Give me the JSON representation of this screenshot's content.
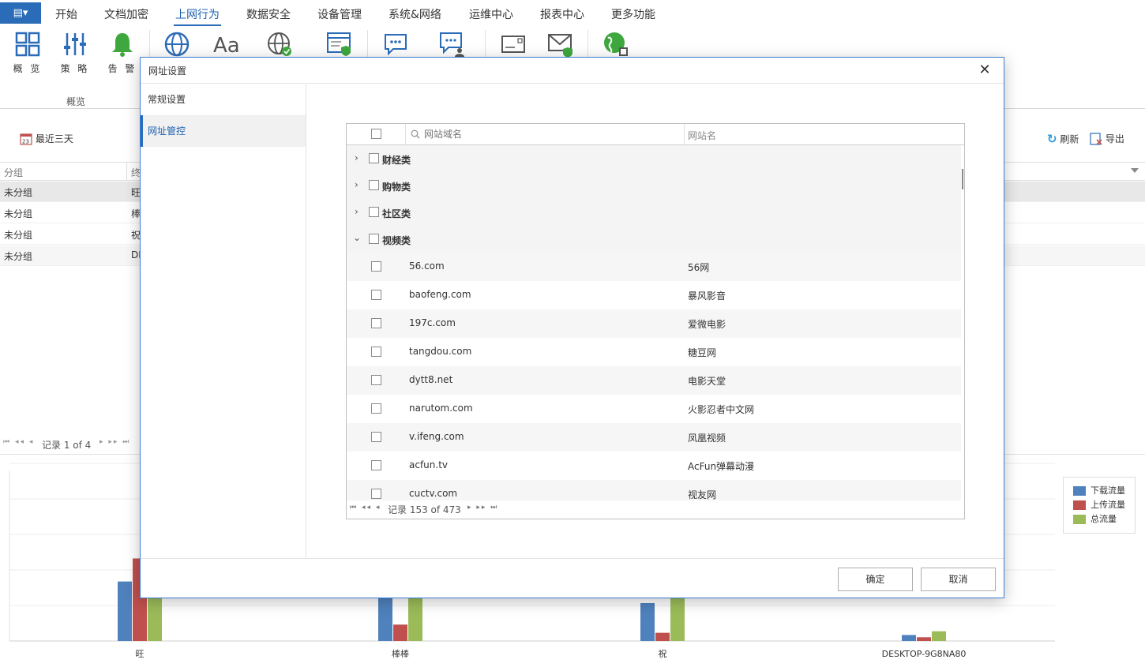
{
  "menubar": {
    "app_button": "▤▾",
    "tabs": [
      "开始",
      "文档加密",
      "上网行为",
      "数据安全",
      "设备管理",
      "系统&网络",
      "运维中心",
      "报表中心",
      "更多功能"
    ],
    "active_tab": "上网行为"
  },
  "ribbon": {
    "buttons": [
      {
        "label": "概 览",
        "icon": "grid-icon"
      },
      {
        "label": "策 略",
        "icon": "sliders-icon"
      },
      {
        "label": "告 警",
        "icon": "bell-icon"
      }
    ],
    "group_label": "概览"
  },
  "background": {
    "date_filter": "最近三天",
    "refresh": "刷新",
    "export": "导出",
    "grid_headers": [
      "分组",
      "终"
    ],
    "rows": [
      {
        "group": "未分组",
        "term": "旺"
      },
      {
        "group": "未分组",
        "term": "棒"
      },
      {
        "group": "未分组",
        "term": "祝"
      },
      {
        "group": "未分组",
        "term": "DI"
      }
    ],
    "pager": "记录 1 of 4",
    "chart_data": {
      "type": "bar",
      "categories": [
        "旺",
        "棒棒",
        "祝",
        "DESKTOP-9G8NA80"
      ],
      "series": [
        {
          "name": "下载流量",
          "color": "#4f81bd",
          "values": [
            80,
            60,
            51,
            8
          ]
        },
        {
          "name": "上传流量",
          "color": "#c0504d",
          "values": [
            111,
            22,
            11,
            5
          ]
        },
        {
          "name": "总流量",
          "color": "#9bbb59",
          "values": [
            191,
            82,
            62,
            13
          ]
        }
      ],
      "xlabel": "",
      "ylabel": "",
      "legend_position": "right",
      "grid": true
    }
  },
  "dialog": {
    "title": "网址设置",
    "close": "✕",
    "nav": [
      {
        "label": "常规设置",
        "active": false
      },
      {
        "label": "网址管控",
        "active": true
      }
    ],
    "table": {
      "search_placeholder": "网站域名",
      "col_name": "网站名",
      "groups": [
        {
          "label": "财经类",
          "expanded": false
        },
        {
          "label": "购物类",
          "expanded": false
        },
        {
          "label": "社区类",
          "expanded": false
        },
        {
          "label": "视频类",
          "expanded": true
        }
      ],
      "rows": [
        {
          "domain": "56.com",
          "name": "56网"
        },
        {
          "domain": "baofeng.com",
          "name": "暴风影音"
        },
        {
          "domain": "197c.com",
          "name": "爱微电影"
        },
        {
          "domain": "tangdou.com",
          "name": "糖豆网"
        },
        {
          "domain": "dytt8.net",
          "name": "电影天堂"
        },
        {
          "domain": "narutom.com",
          "name": "火影忍者中文网"
        },
        {
          "domain": "v.ifeng.com",
          "name": "凤凰视频"
        },
        {
          "domain": "acfun.tv",
          "name": "AcFun弹幕动漫"
        },
        {
          "domain": "cuctv.com",
          "name": "视友网"
        }
      ],
      "pager": "记录 153 of 473"
    },
    "ok": "确定",
    "cancel": "取消"
  }
}
